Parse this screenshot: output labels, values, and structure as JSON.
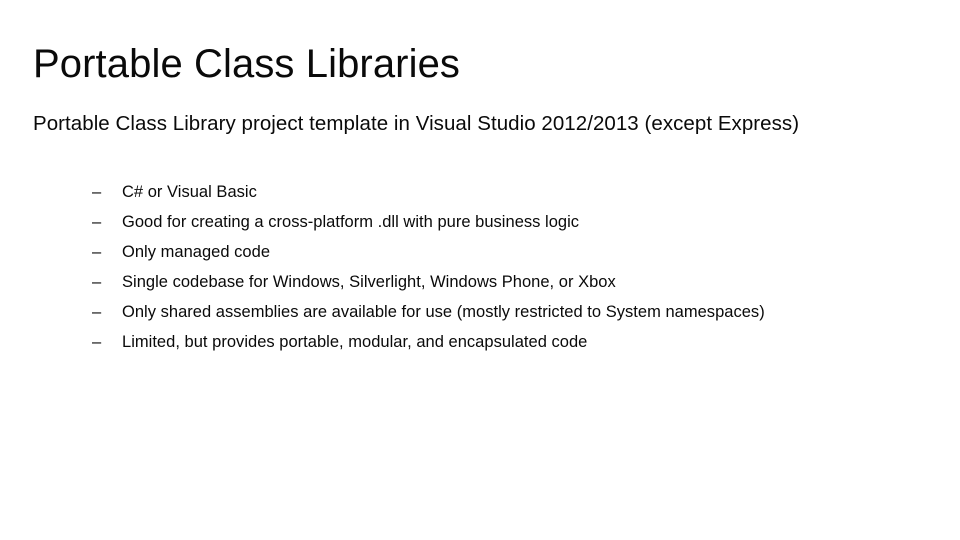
{
  "slide": {
    "title": "Portable Class Libraries",
    "lead": "Portable Class Library project template in Visual Studio 2012/2013 (except Express)",
    "bullet_marker": "–",
    "bullets": [
      {
        "text": "C# or Visual Basic"
      },
      {
        "text": "Good for creating a cross-platform .dll with pure business logic"
      },
      {
        "text": "Only managed code"
      },
      {
        "text": "Single codebase for Windows, Silverlight, Windows Phone, or Xbox"
      },
      {
        "text": "Only shared assemblies are available for use (mostly restricted to System namespaces)"
      },
      {
        "text": "Limited, but provides portable, modular, and encapsulated code"
      }
    ],
    "colors": {
      "background": "#ffffff",
      "text": "#0a0a0a"
    }
  }
}
